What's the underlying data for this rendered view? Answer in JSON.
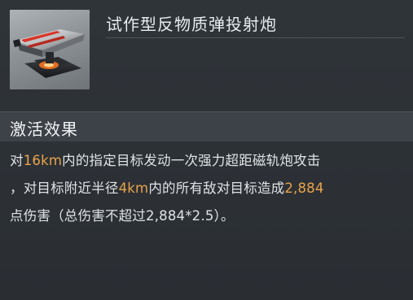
{
  "item": {
    "name": "试作型反物质弹投射炮",
    "image_icon": "antimatter-cannon-turret"
  },
  "effect": {
    "title": "激活效果",
    "lines": [
      [
        {
          "text": "对",
          "highlight": false
        },
        {
          "text": "16km",
          "highlight": true
        },
        {
          "text": "内的指定目标发动一次强力超距磁轨炮攻击",
          "highlight": false
        }
      ],
      [
        {
          "text": "，对目标附近半径",
          "highlight": false
        },
        {
          "text": "4km",
          "highlight": true
        },
        {
          "text": "内的所有敌对目标造成",
          "highlight": false
        },
        {
          "text": "2,884",
          "highlight": true
        }
      ],
      [
        {
          "text": "点伤害（总伤害不超过2,884*2.5）。",
          "highlight": false
        }
      ]
    ]
  },
  "colors": {
    "highlight": "#e8a34a",
    "text": "#dfe3e6",
    "section_bg": "#3d4248",
    "panel_bg": "#2c3036"
  }
}
